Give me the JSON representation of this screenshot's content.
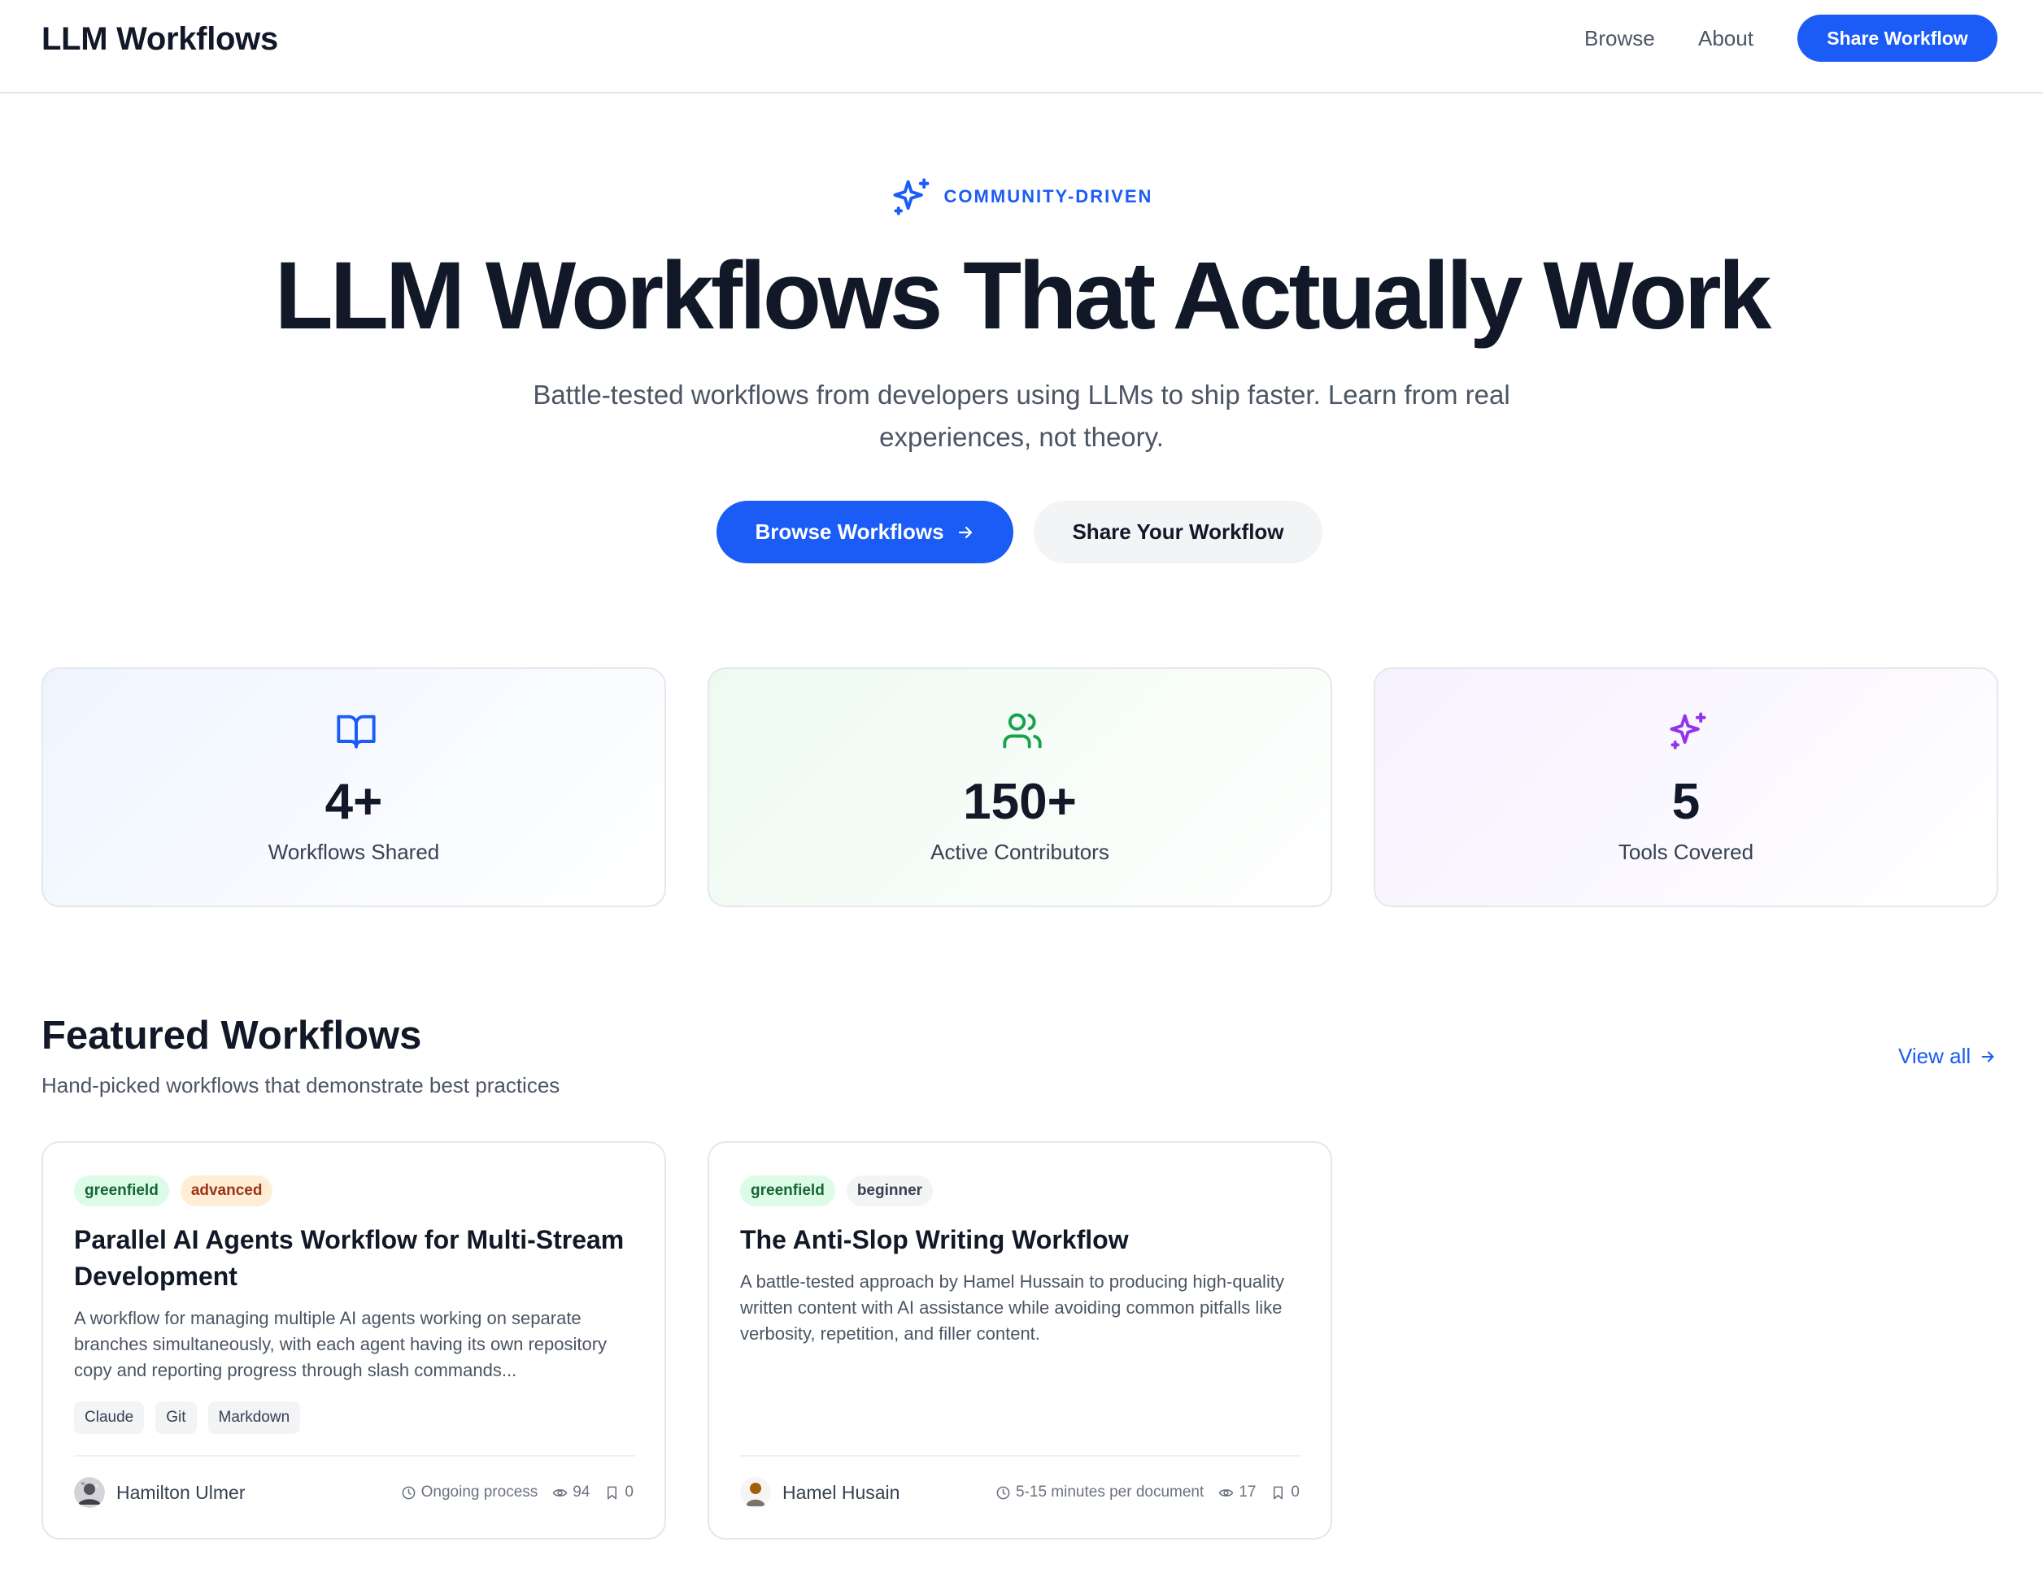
{
  "header": {
    "brand": "LLM Workflows",
    "nav": {
      "browse": "Browse",
      "about": "About"
    },
    "cta": "Share Workflow"
  },
  "hero": {
    "eyebrow": "COMMUNITY-DRIVEN",
    "title": "LLM Workflows That Actually Work",
    "subtitle": "Battle-tested workflows from developers using LLMs to ship faster. Learn from real experiences, not theory.",
    "primary_button": "Browse Workflows",
    "secondary_button": "Share Your Workflow"
  },
  "stats": [
    {
      "value": "4+",
      "label": "Workflows Shared",
      "icon": "book-open-icon",
      "color": "#1a5cf5"
    },
    {
      "value": "150+",
      "label": "Active Contributors",
      "icon": "users-icon",
      "color": "#16a34a"
    },
    {
      "value": "5",
      "label": "Tools Covered",
      "icon": "sparkles-icon",
      "color": "#9333ea"
    }
  ],
  "featured": {
    "title": "Featured Workflows",
    "subtitle": "Hand-picked workflows that demonstrate best practices",
    "view_all": "View all",
    "cards": [
      {
        "badges": [
          "greenfield",
          "advanced"
        ],
        "title": "Parallel AI Agents Workflow for Multi-Stream Development",
        "description": "A workflow for managing multiple AI agents working on separate branches simultaneously, with each agent having its own repository copy and reporting progress through slash commands...",
        "tags": [
          "Claude",
          "Git",
          "Markdown"
        ],
        "author": "Hamilton Ulmer",
        "duration": "Ongoing process",
        "views": "94",
        "bookmarks": "0"
      },
      {
        "badges": [
          "greenfield",
          "beginner"
        ],
        "title": "The Anti-Slop Writing Workflow",
        "description": "A battle-tested approach by Hamel Hussain to producing high-quality written content with AI assistance while avoiding common pitfalls like verbosity, repetition, and filler content.",
        "tags": [],
        "author": "Hamel Husain",
        "duration": "5-15 minutes per document",
        "views": "17",
        "bookmarks": "0"
      }
    ]
  },
  "colors": {
    "accent": "#1a5cf5",
    "text": "#111827",
    "muted": "#4b5563",
    "border": "#e5e7eb"
  }
}
